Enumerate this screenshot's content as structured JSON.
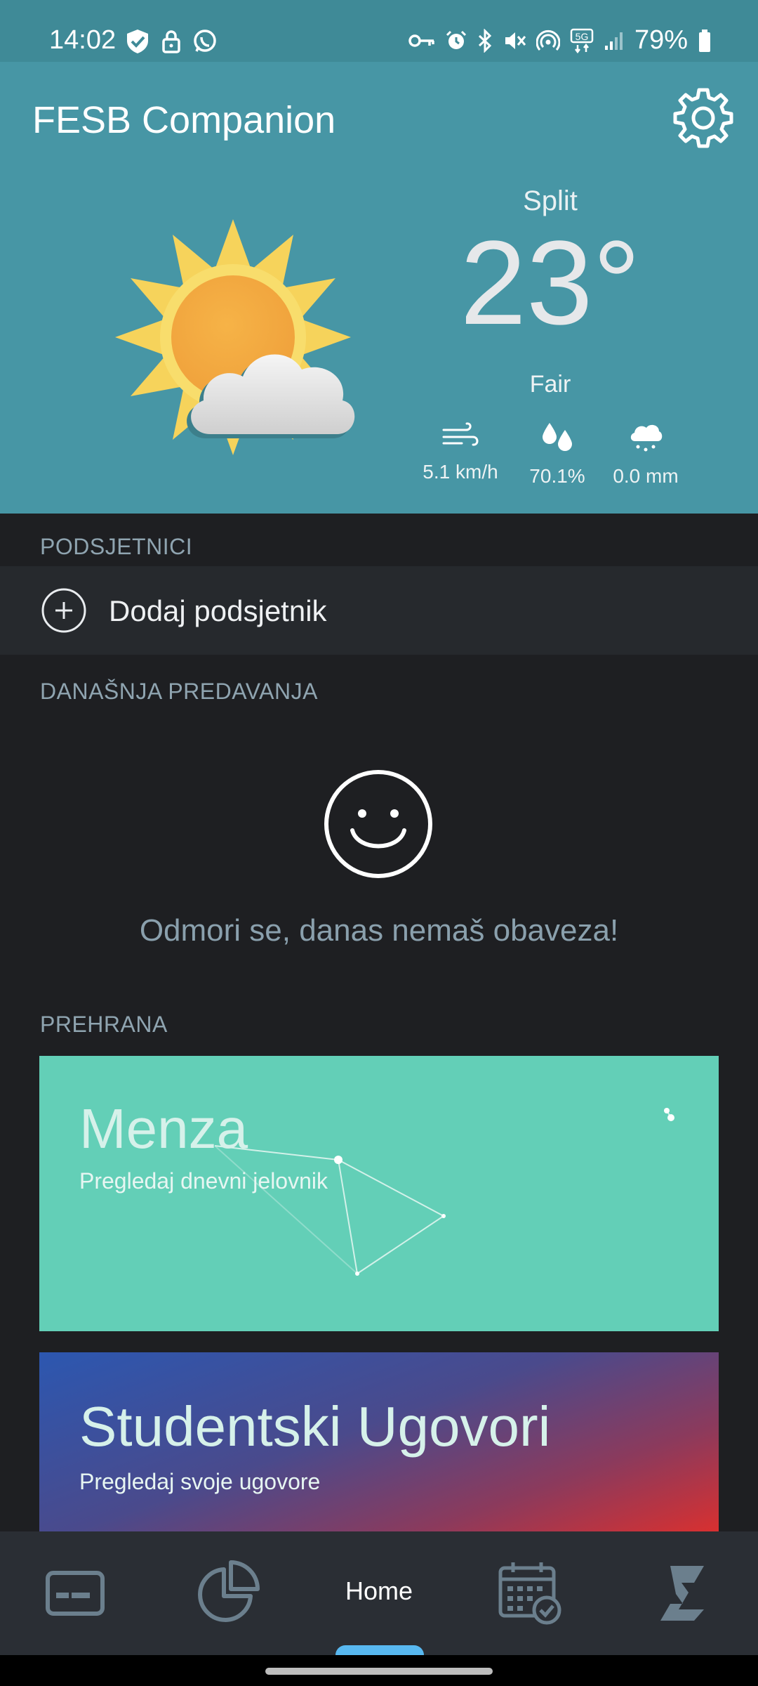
{
  "status_bar": {
    "time": "14:02",
    "battery": "79%",
    "network": "5G"
  },
  "header": {
    "app_title": "FESB Companion",
    "weather": {
      "city": "Split",
      "temperature": "23°",
      "condition": "Fair",
      "wind": "5.1 km/h",
      "humidity": "70.1%",
      "precipitation": "0.0 mm"
    }
  },
  "reminders": {
    "section_title": "PODSJETNICI",
    "add_label": "Dodaj podsjetnik"
  },
  "lectures": {
    "section_title": "DANAŠNJA PREDAVANJA",
    "empty_message": "Odmori se, danas nemaš obaveza!"
  },
  "food": {
    "section_title": "PREHRANA",
    "cards": [
      {
        "title": "Menza",
        "subtitle": "Pregledaj dnevni jelovnik",
        "color": "#63cfb7"
      },
      {
        "title": "Studentski Ugovori",
        "subtitle": "Pregledaj svoje ugovore"
      }
    ]
  },
  "bottom_nav": {
    "items": [
      {
        "icon": "id-card-icon"
      },
      {
        "icon": "pie-chart-icon"
      },
      {
        "label": "Home"
      },
      {
        "icon": "calendar-check-icon"
      },
      {
        "icon": "studomat-logo-icon"
      }
    ],
    "active_color": "#58b8f0"
  },
  "colors": {
    "header_bg": "#4796a5",
    "background": "#1e1f22",
    "section_label": "#8fa4b0"
  }
}
